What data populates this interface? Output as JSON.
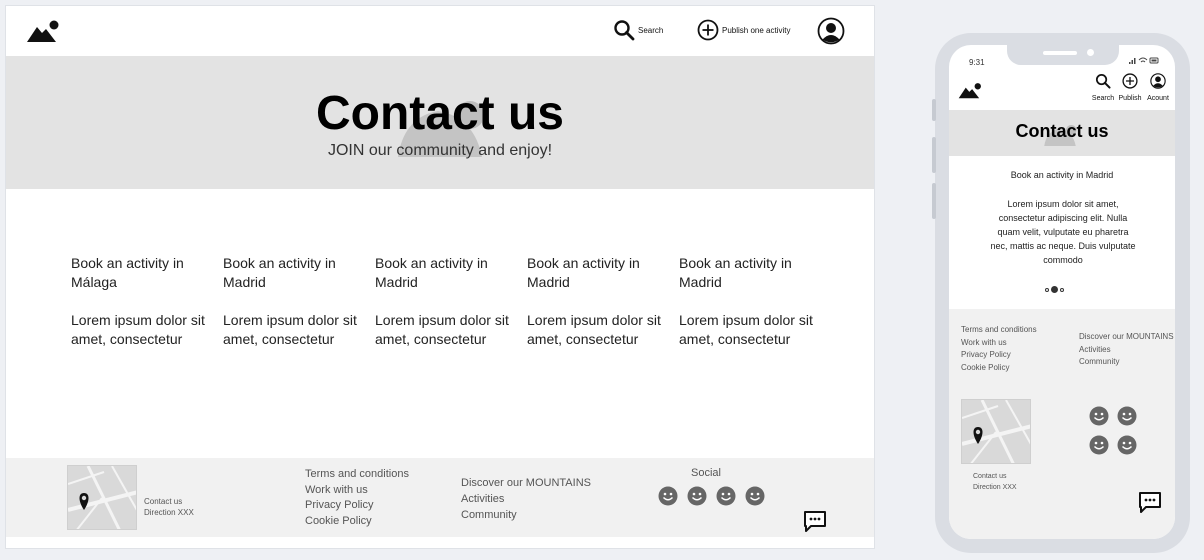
{
  "desktop": {
    "nav": {
      "logo_icon": "mountain-logo-icon",
      "search_label": "Search",
      "publish_label": "Publish one activity",
      "account_icon": "user-account-icon"
    },
    "hero": {
      "title": "Contact us",
      "subtitle": "JOIN our community and enjoy!"
    },
    "cards": [
      {
        "title": "Book an activity in Málaga",
        "text": "Lorem ipsum dolor sit amet, consectetur"
      },
      {
        "title": "Book an activity in Madrid",
        "text": "Lorem ipsum dolor sit amet, consectetur"
      },
      {
        "title": "Book an activity in Madrid",
        "text": "Lorem ipsum dolor sit amet, consectetur"
      },
      {
        "title": "Book an activity in Madrid",
        "text": "Lorem ipsum dolor sit amet, consectetur"
      },
      {
        "title": "Book an activity in Madrid",
        "text": "Lorem ipsum dolor sit amet, consectetur"
      }
    ],
    "footer": {
      "contact_line1": "Contact us",
      "contact_line2": "Direction XXX",
      "links_legal": [
        "Terms and conditions",
        "Work with us",
        "Privacy Policy",
        "Cookie Policy"
      ],
      "links_discover": [
        "Discover our MOUNTAINS",
        "Activities",
        "Community"
      ],
      "social_label": "Social",
      "social_icons": [
        "smiley-icon",
        "smiley-icon",
        "smiley-icon",
        "smiley-icon"
      ],
      "chat_icon": "chat-icon"
    }
  },
  "mobile": {
    "status": {
      "time": "9:31"
    },
    "nav": {
      "search_label": "Search",
      "publish_label": "Publish",
      "account_label": "Acount"
    },
    "hero": {
      "title": "Contact us"
    },
    "card": {
      "title": "Book an activity in Madrid",
      "text": "Lorem ipsum dolor sit amet, consectetur adipiscing elit. Nulla quam velit, vulputate eu pharetra nec, mattis ac neque. Duis vulputate commodo"
    },
    "carousel": {
      "active_index": 1,
      "count": 3
    },
    "footer": {
      "links_legal": [
        "Terms and conditions",
        "Work with us",
        "Privacy Policy",
        "Cookie Policy"
      ],
      "links_discover": [
        "Discover our MOUNTAINS",
        "Activities",
        "Community"
      ],
      "contact_line1": "Contact us",
      "contact_line2": "Direction XXX"
    }
  },
  "colors": {
    "hero_bg": "#e3e3e3",
    "footer_bg": "#f1f1f1",
    "page_bg": "#eef0f4",
    "icon_dark": "#111111",
    "icon_gray": "#666666"
  }
}
